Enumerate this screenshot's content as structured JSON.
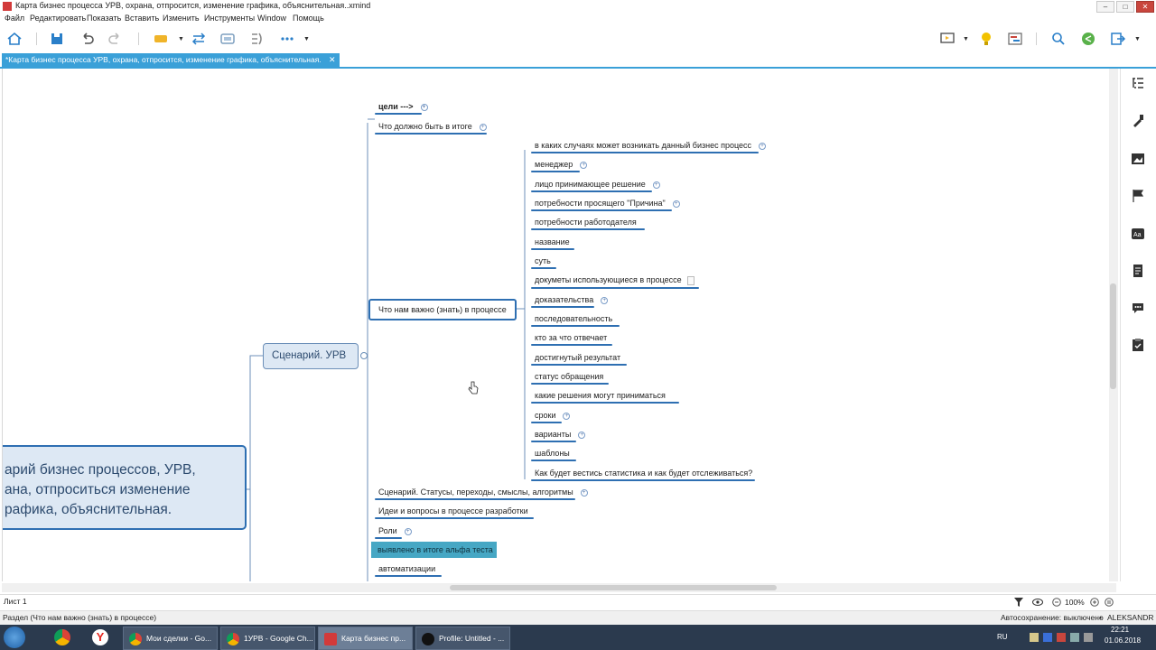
{
  "window": {
    "title": "Карта бизнес процесса УРВ, охрана, отпросится, изменение графика, объяснительная..xmind"
  },
  "menu": [
    "Файл",
    "Редактировать",
    "Показать",
    "Вставить",
    "Изменить",
    "Инструменты",
    "Window",
    "Помощь"
  ],
  "tab": {
    "label": "*Карта бизнес процесса УРВ, охрана, отпросится, изменение графика, объяснительная.",
    "close": "✕"
  },
  "mindmap": {
    "central_line1": "арий бизнес процессов, УРВ,",
    "central_line2": "ана, отпроситься изменение",
    "central_line3": "рафика, объяснительная.",
    "scenario": "Сценарий. УРВ",
    "goals": "цели --->",
    "result": "Что должно быть в итоге",
    "important": "Что нам важно (знать) в процессе",
    "sub_items": [
      "в каких случаях может возникать данный бизнес процесс",
      "менеджер",
      "лицо принимающее решение",
      "потребности просящего \"Причина\"",
      "потребности работодателя",
      "название",
      "суть",
      "докуметы использующиеся в процессе",
      "доказательства",
      "последовательность",
      "кто за что отвечает",
      "достигнутый результат",
      "статус обращения",
      "какие решения могут приниматься",
      "сроки",
      "варианты",
      "шаблоны",
      "Как будет вестись статистика и как будет отслеживаться?"
    ],
    "statuses": "Сценарий. Статусы, переходы, смыслы, алгоритмы",
    "ideas": "Идеи и вопросы в процессе разработки",
    "roles": "Роли",
    "alpha": "выявлено в итоге альфа теста",
    "automation": "автоматизации"
  },
  "sheet": {
    "tab": "Лист 1",
    "zoom": "100%"
  },
  "status": {
    "left": "Раздел (Что нам важно (знать) в процессе)",
    "autosave": "Автосохранение: выключено",
    "user": "ALEKSANDR"
  },
  "taskbar": {
    "tasks": [
      "Мои сделки - Go...",
      "1УРВ - Google Ch...",
      "Карта бизнес пр...",
      "Profile: Untitled - ..."
    ],
    "lang": "RU",
    "time": "22:21",
    "date": "01.06.2018"
  },
  "colors": {
    "accent": "#3aa0d8",
    "node_border": "#2e6fb2",
    "node_fill": "#dde8f4",
    "alpha_fill": "#46a7c4"
  }
}
